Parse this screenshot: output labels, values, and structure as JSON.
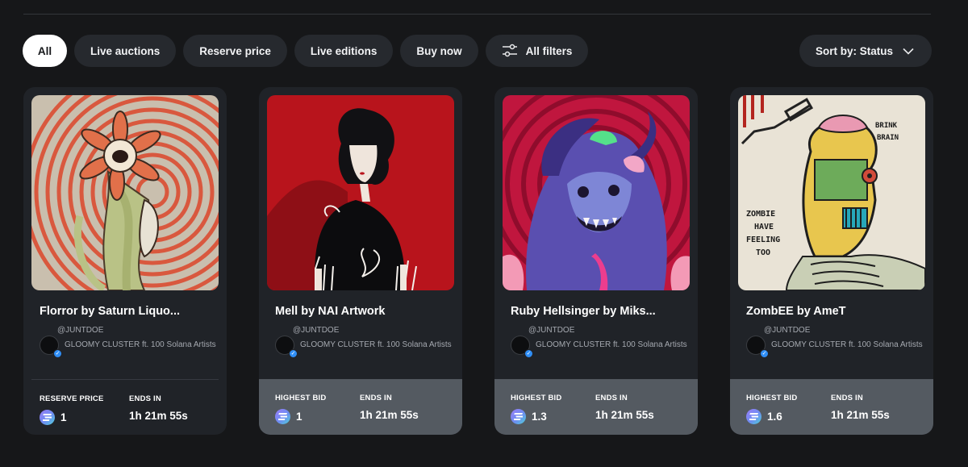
{
  "filters": {
    "all": "All",
    "live_auctions": "Live auctions",
    "reserve_price": "Reserve price",
    "live_editions": "Live editions",
    "buy_now": "Buy now",
    "all_filters": "All filters",
    "sort": "Sort by: Status"
  },
  "colors": {
    "background": "#161719",
    "card": "#202328",
    "pill": "#26292e",
    "bid_footer": "#545a61",
    "verified": "#2f8ef6"
  },
  "cards": [
    {
      "title": "Florror by Saturn Liquo...",
      "handle": "@JUNTDOE",
      "collection": "GLOOMY CLUSTER ft. 100 Solana Artists",
      "price_label": "RESERVE PRICE",
      "price": "1",
      "ends_label": "ENDS IN",
      "ends": "1h 21m 55s"
    },
    {
      "title": "Mell by NAI Artwork",
      "handle": "@JUNTDOE",
      "collection": "GLOOMY CLUSTER ft. 100 Solana Artists",
      "price_label": "HIGHEST BID",
      "price": "1",
      "ends_label": "ENDS IN",
      "ends": "1h 21m 55s"
    },
    {
      "title": "Ruby Hellsinger by Miks...",
      "handle": "@JUNTDOE",
      "collection": "GLOOMY CLUSTER ft. 100 Solana Artists",
      "price_label": "HIGHEST BID",
      "price": "1.3",
      "ends_label": "ENDS IN",
      "ends": "1h 21m 55s"
    },
    {
      "title": "ZombEE by AmeT",
      "handle": "@JUNTDOE",
      "collection": "GLOOMY CLUSTER ft. 100 Solana Artists",
      "price_label": "HIGHEST BID",
      "price": "1.6",
      "ends_label": "ENDS IN",
      "ends": "1h 21m 55s",
      "art_text": {
        "line1": "BRINK",
        "line2": "BRAIN",
        "line3": "ZOMBIE",
        "line4": "HAVE",
        "line5": "FEELING",
        "line6": "TOO"
      }
    }
  ],
  "icons": {
    "filters": "sliders-icon",
    "sort": "chevron-down-icon",
    "currency": "solana-icon",
    "verified": "verified-check-icon"
  }
}
